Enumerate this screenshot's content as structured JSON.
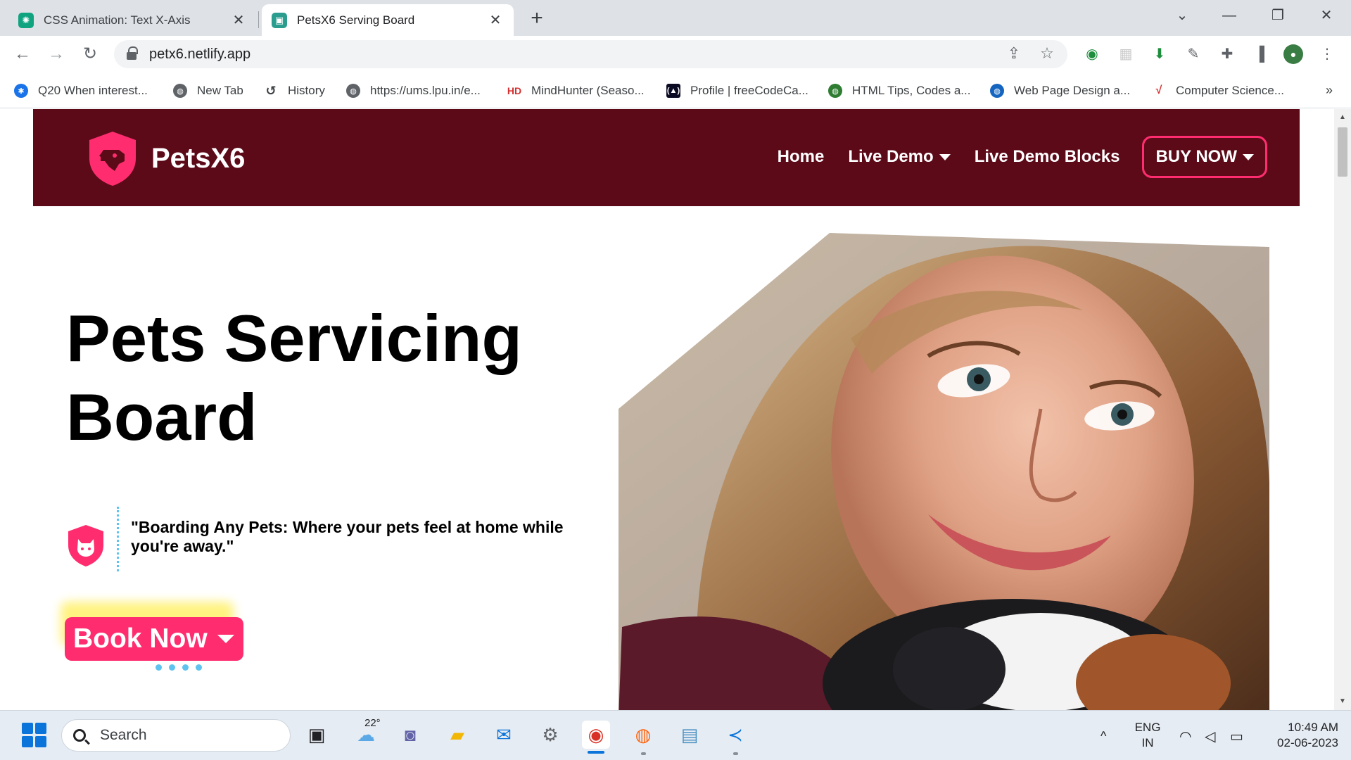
{
  "browser": {
    "tabs": [
      {
        "title": "CSS Animation: Text X-Axis",
        "active": false
      },
      {
        "title": "PetsX6 Serving Board",
        "active": true
      }
    ],
    "new_tab_label": "+",
    "window_controls": {
      "minimize": "—",
      "restore": "❐",
      "close": "✕",
      "tab_search": "⌄"
    },
    "nav": {
      "back": "←",
      "forward": "→",
      "reload": "↻"
    },
    "url": "petx6.netlify.app",
    "bookmarks": [
      "Q20 When interest...",
      "New Tab",
      "History",
      "https://ums.lpu.in/e...",
      "MindHunter (Seaso...",
      "Profile | freeCodeCa...",
      "HTML Tips, Codes a...",
      "Web Page Design a...",
      "Computer Science..."
    ],
    "bookmarks_more": "»"
  },
  "site": {
    "brand": "PetsX6",
    "nav": {
      "home": "Home",
      "live_demo": "Live Demo",
      "live_demo_blocks": "Live Demo Blocks",
      "buy_now": "BUY NOW"
    },
    "hero": {
      "title_line1": "Pets Servicing",
      "title_line2": "Board",
      "tagline": "\"Boarding Any Pets: Where your pets feel at home while you're away.\"",
      "cta": "Book Now"
    },
    "colors": {
      "header_bg": "#5c0a18",
      "accent": "#ff2d6f",
      "dots": "#5ec4ef",
      "glow": "#fff06a"
    }
  },
  "taskbar": {
    "search_label": "Search",
    "weather_temp": "22°",
    "language_line1": "ENG",
    "language_line2": "IN",
    "time": "10:49 AM",
    "date": "02-06-2023",
    "tray_chevron": "^"
  }
}
